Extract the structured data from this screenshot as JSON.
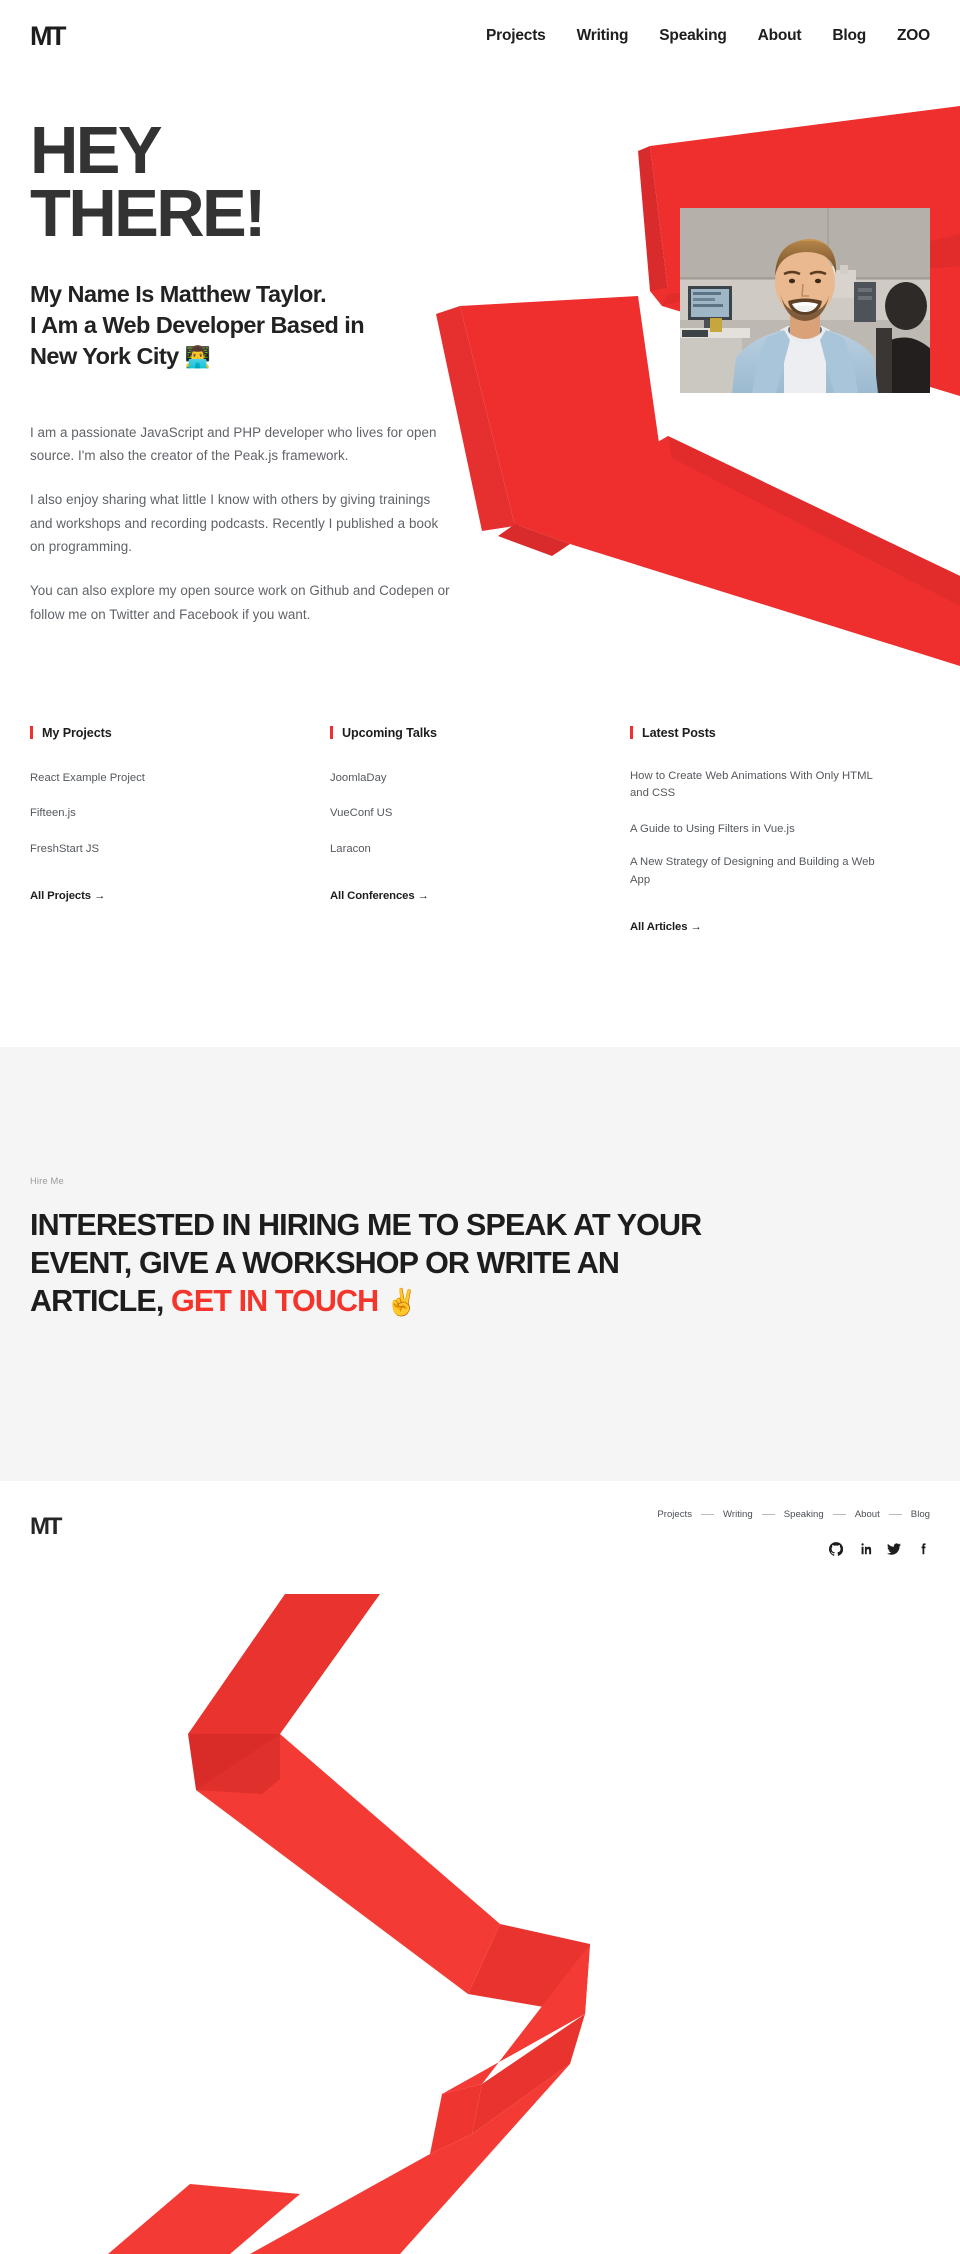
{
  "header": {
    "logo": "MT",
    "nav": [
      {
        "label": "Projects"
      },
      {
        "label": "Writing"
      },
      {
        "label": "Speaking"
      },
      {
        "label": "About"
      },
      {
        "label": "Blog"
      },
      {
        "label": "ZOO"
      }
    ]
  },
  "hero": {
    "title_line1": "HEY",
    "title_line2": "THERE!",
    "subtitle_line1": "My Name Is Matthew Taylor.",
    "subtitle_line2": "I Am a Web Developer Based in",
    "subtitle_line3": "New York City",
    "subtitle_emoji": "👨‍💻",
    "paragraphs": [
      "I am a passionate JavaScript and PHP developer who lives for open source. I'm also the creator of the Peak.js framework.",
      "I also enjoy sharing what little I know with others by giving trainings and workshops and recording podcasts. Recently I published a book on programming.",
      "You can also explore my open source work on Github and Codepen or follow me on Twitter and Facebook if you want."
    ],
    "photo_alt": "portrait-photo-of-matthew-taylor-smiling-in-an-office"
  },
  "columns": [
    {
      "title": "My Projects",
      "items": [
        "React Example Project",
        "Fifteen.js",
        "FreshStart JS"
      ],
      "more": "All Projects →"
    },
    {
      "title": "Upcoming Talks",
      "items": [
        "JoomlaDay",
        "VueConf US",
        "Laracon"
      ],
      "more": "All Conferences →"
    },
    {
      "title": "Latest Posts",
      "items": [
        "How to Create Web Animations With Only HTML and CSS",
        "A Guide to Using Filters in Vue.js",
        "A New Strategy of Designing and Building a Web App"
      ],
      "more": "All Articles →"
    }
  ],
  "hire": {
    "label": "Hire Me",
    "text_before": "INTERESTED IN HIRING ME TO SPEAK AT YOUR EVENT, GIVE A WORKSHOP OR WRITE AN ARTICLE,",
    "link": "GET IN TOUCH",
    "emoji": "✌️"
  },
  "footer": {
    "logo": "MT",
    "nav": [
      {
        "label": "Projects"
      },
      {
        "label": "Writing"
      },
      {
        "label": "Speaking"
      },
      {
        "label": "About"
      },
      {
        "label": "Blog"
      }
    ],
    "social": [
      {
        "name": "github"
      },
      {
        "name": "linkedin"
      },
      {
        "name": "twitter"
      },
      {
        "name": "facebook"
      }
    ]
  },
  "colors": {
    "accent_red": "#f03030",
    "ribbon_red": "#ef2e2e",
    "ribbon_red_dark": "#d92b2b",
    "text_dark": "#1d1d1d",
    "text_body": "#5f6368",
    "hire_bg": "#f5f5f5"
  }
}
